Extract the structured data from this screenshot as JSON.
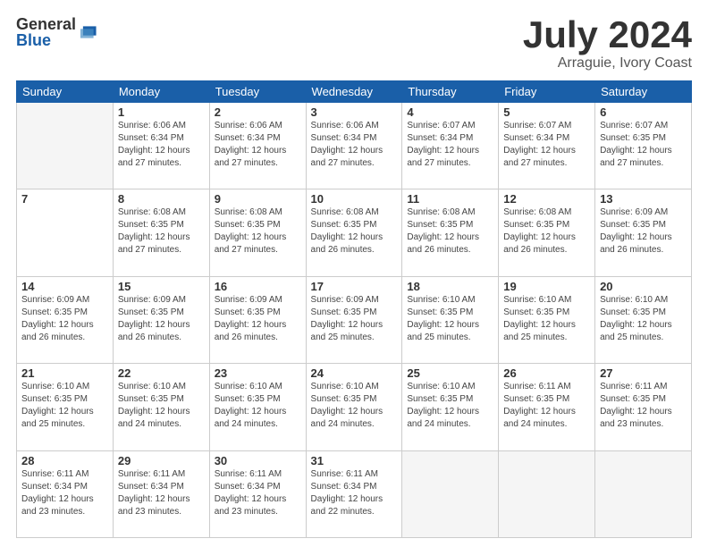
{
  "logo": {
    "general": "General",
    "blue": "Blue"
  },
  "header": {
    "month": "July 2024",
    "location": "Arraguie, Ivory Coast"
  },
  "days_of_week": [
    "Sunday",
    "Monday",
    "Tuesday",
    "Wednesday",
    "Thursday",
    "Friday",
    "Saturday"
  ],
  "weeks": [
    [
      {
        "day": "",
        "info": ""
      },
      {
        "day": "1",
        "info": "Sunrise: 6:06 AM\nSunset: 6:34 PM\nDaylight: 12 hours\nand 27 minutes."
      },
      {
        "day": "2",
        "info": "Sunrise: 6:06 AM\nSunset: 6:34 PM\nDaylight: 12 hours\nand 27 minutes."
      },
      {
        "day": "3",
        "info": "Sunrise: 6:06 AM\nSunset: 6:34 PM\nDaylight: 12 hours\nand 27 minutes."
      },
      {
        "day": "4",
        "info": "Sunrise: 6:07 AM\nSunset: 6:34 PM\nDaylight: 12 hours\nand 27 minutes."
      },
      {
        "day": "5",
        "info": "Sunrise: 6:07 AM\nSunset: 6:34 PM\nDaylight: 12 hours\nand 27 minutes."
      },
      {
        "day": "6",
        "info": "Sunrise: 6:07 AM\nSunset: 6:35 PM\nDaylight: 12 hours\nand 27 minutes."
      }
    ],
    [
      {
        "day": "7",
        "info": ""
      },
      {
        "day": "8",
        "info": "Sunrise: 6:08 AM\nSunset: 6:35 PM\nDaylight: 12 hours\nand 27 minutes."
      },
      {
        "day": "9",
        "info": "Sunrise: 6:08 AM\nSunset: 6:35 PM\nDaylight: 12 hours\nand 27 minutes."
      },
      {
        "day": "10",
        "info": "Sunrise: 6:08 AM\nSunset: 6:35 PM\nDaylight: 12 hours\nand 26 minutes."
      },
      {
        "day": "11",
        "info": "Sunrise: 6:08 AM\nSunset: 6:35 PM\nDaylight: 12 hours\nand 26 minutes."
      },
      {
        "day": "12",
        "info": "Sunrise: 6:08 AM\nSunset: 6:35 PM\nDaylight: 12 hours\nand 26 minutes."
      },
      {
        "day": "13",
        "info": "Sunrise: 6:09 AM\nSunset: 6:35 PM\nDaylight: 12 hours\nand 26 minutes."
      }
    ],
    [
      {
        "day": "14",
        "info": "Sunrise: 6:09 AM\nSunset: 6:35 PM\nDaylight: 12 hours\nand 26 minutes."
      },
      {
        "day": "15",
        "info": "Sunrise: 6:09 AM\nSunset: 6:35 PM\nDaylight: 12 hours\nand 26 minutes."
      },
      {
        "day": "16",
        "info": "Sunrise: 6:09 AM\nSunset: 6:35 PM\nDaylight: 12 hours\nand 26 minutes."
      },
      {
        "day": "17",
        "info": "Sunrise: 6:09 AM\nSunset: 6:35 PM\nDaylight: 12 hours\nand 25 minutes."
      },
      {
        "day": "18",
        "info": "Sunrise: 6:10 AM\nSunset: 6:35 PM\nDaylight: 12 hours\nand 25 minutes."
      },
      {
        "day": "19",
        "info": "Sunrise: 6:10 AM\nSunset: 6:35 PM\nDaylight: 12 hours\nand 25 minutes."
      },
      {
        "day": "20",
        "info": "Sunrise: 6:10 AM\nSunset: 6:35 PM\nDaylight: 12 hours\nand 25 minutes."
      }
    ],
    [
      {
        "day": "21",
        "info": "Sunrise: 6:10 AM\nSunset: 6:35 PM\nDaylight: 12 hours\nand 25 minutes."
      },
      {
        "day": "22",
        "info": "Sunrise: 6:10 AM\nSunset: 6:35 PM\nDaylight: 12 hours\nand 24 minutes."
      },
      {
        "day": "23",
        "info": "Sunrise: 6:10 AM\nSunset: 6:35 PM\nDaylight: 12 hours\nand 24 minutes."
      },
      {
        "day": "24",
        "info": "Sunrise: 6:10 AM\nSunset: 6:35 PM\nDaylight: 12 hours\nand 24 minutes."
      },
      {
        "day": "25",
        "info": "Sunrise: 6:10 AM\nSunset: 6:35 PM\nDaylight: 12 hours\nand 24 minutes."
      },
      {
        "day": "26",
        "info": "Sunrise: 6:11 AM\nSunset: 6:35 PM\nDaylight: 12 hours\nand 24 minutes."
      },
      {
        "day": "27",
        "info": "Sunrise: 6:11 AM\nSunset: 6:35 PM\nDaylight: 12 hours\nand 23 minutes."
      }
    ],
    [
      {
        "day": "28",
        "info": "Sunrise: 6:11 AM\nSunset: 6:34 PM\nDaylight: 12 hours\nand 23 minutes."
      },
      {
        "day": "29",
        "info": "Sunrise: 6:11 AM\nSunset: 6:34 PM\nDaylight: 12 hours\nand 23 minutes."
      },
      {
        "day": "30",
        "info": "Sunrise: 6:11 AM\nSunset: 6:34 PM\nDaylight: 12 hours\nand 23 minutes."
      },
      {
        "day": "31",
        "info": "Sunrise: 6:11 AM\nSunset: 6:34 PM\nDaylight: 12 hours\nand 22 minutes."
      },
      {
        "day": "",
        "info": ""
      },
      {
        "day": "",
        "info": ""
      },
      {
        "day": "",
        "info": ""
      }
    ]
  ]
}
